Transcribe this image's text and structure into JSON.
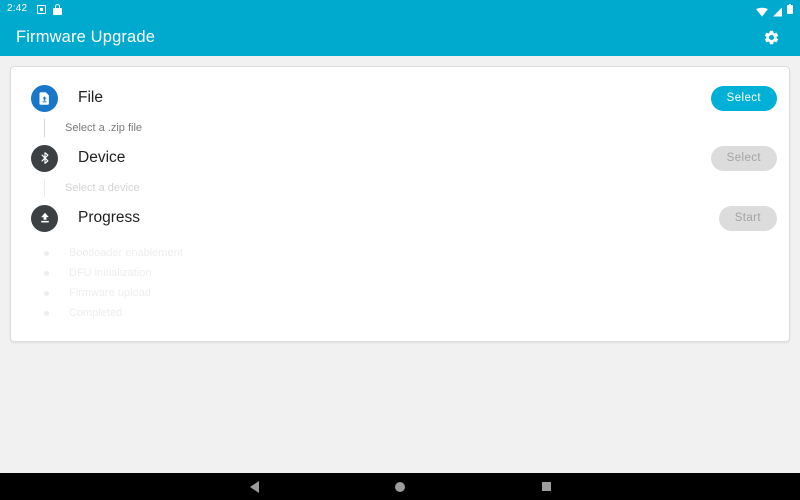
{
  "status_bar": {
    "clock": "2:42",
    "left_icons": [
      "screenshot-icon",
      "lock-icon"
    ],
    "right_icons": [
      "wifi-icon",
      "signal-icon",
      "battery-icon"
    ],
    "background": "#00a9ce"
  },
  "app_bar": {
    "title": "Firmware Upgrade",
    "settings_icon": "gear-icon",
    "background": "#00a9ce",
    "title_color": "#ffffff"
  },
  "card": {
    "steps": [
      {
        "key": "file",
        "title": "File",
        "icon": "file-upload-icon",
        "icon_bg": "#1877c9",
        "subtitle": "Select a .zip file",
        "subtitle_state": "active",
        "button": {
          "label": "Select",
          "enabled": true,
          "color": "#00b0d7",
          "text_color": "#ffffff"
        }
      },
      {
        "key": "device",
        "title": "Device",
        "icon": "bluetooth-icon",
        "icon_bg": "#3c4043",
        "subtitle": "Select a device",
        "subtitle_state": "disabled",
        "button": {
          "label": "Select",
          "enabled": false,
          "color": "#dcdcdc",
          "text_color": "#a3a3a3"
        }
      },
      {
        "key": "progress",
        "title": "Progress",
        "icon": "upload-icon",
        "icon_bg": "#3c4043",
        "button": {
          "label": "Start",
          "enabled": false,
          "color": "#dcdcdc",
          "text_color": "#a3a3a3"
        }
      }
    ],
    "progress_steps": [
      {
        "label": "Bootloader enablement",
        "state": "pending"
      },
      {
        "label": "DFU initialization",
        "state": "pending"
      },
      {
        "label": "Firmware upload",
        "state": "pending"
      },
      {
        "label": "Completed",
        "state": "pending"
      }
    ]
  },
  "nav_bar": {
    "buttons": [
      "back-icon",
      "home-icon",
      "recents-icon"
    ],
    "background": "#000000"
  }
}
